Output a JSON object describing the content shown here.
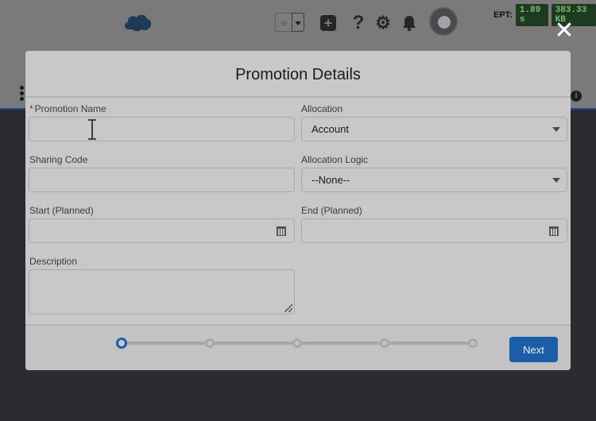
{
  "header": {
    "ept_label": "EPT:",
    "ept_value": "1.89 s",
    "memory_value": "383.33 KB"
  },
  "modal": {
    "title": "Promotion Details",
    "fields": {
      "promotion_name": {
        "required_marker": "*",
        "label": "Promotion Name",
        "value": ""
      },
      "allocation": {
        "label": "Allocation",
        "value": "Account"
      },
      "sharing_code": {
        "label": "Sharing Code",
        "value": ""
      },
      "allocation_logic": {
        "label": "Allocation Logic",
        "value": "--None--"
      },
      "start_planned": {
        "label": "Start (Planned)",
        "value": ""
      },
      "end_planned": {
        "label": "End (Planned)",
        "value": ""
      },
      "description": {
        "label": "Description",
        "value": ""
      }
    },
    "footer": {
      "next_label": "Next",
      "progress_steps": 5,
      "current_step": 1
    }
  },
  "colors": {
    "brand_blue": "#1a5ea8",
    "overlay_bg": "#2a2c31",
    "modal_bg": "#c8c8c8"
  },
  "icons": [
    "salesforce-cloud-icon",
    "favorites-star-icon",
    "add-icon",
    "help-icon",
    "setup-gear-icon",
    "notifications-bell-icon",
    "close-icon",
    "calendar-icon",
    "text-cursor-icon"
  ]
}
